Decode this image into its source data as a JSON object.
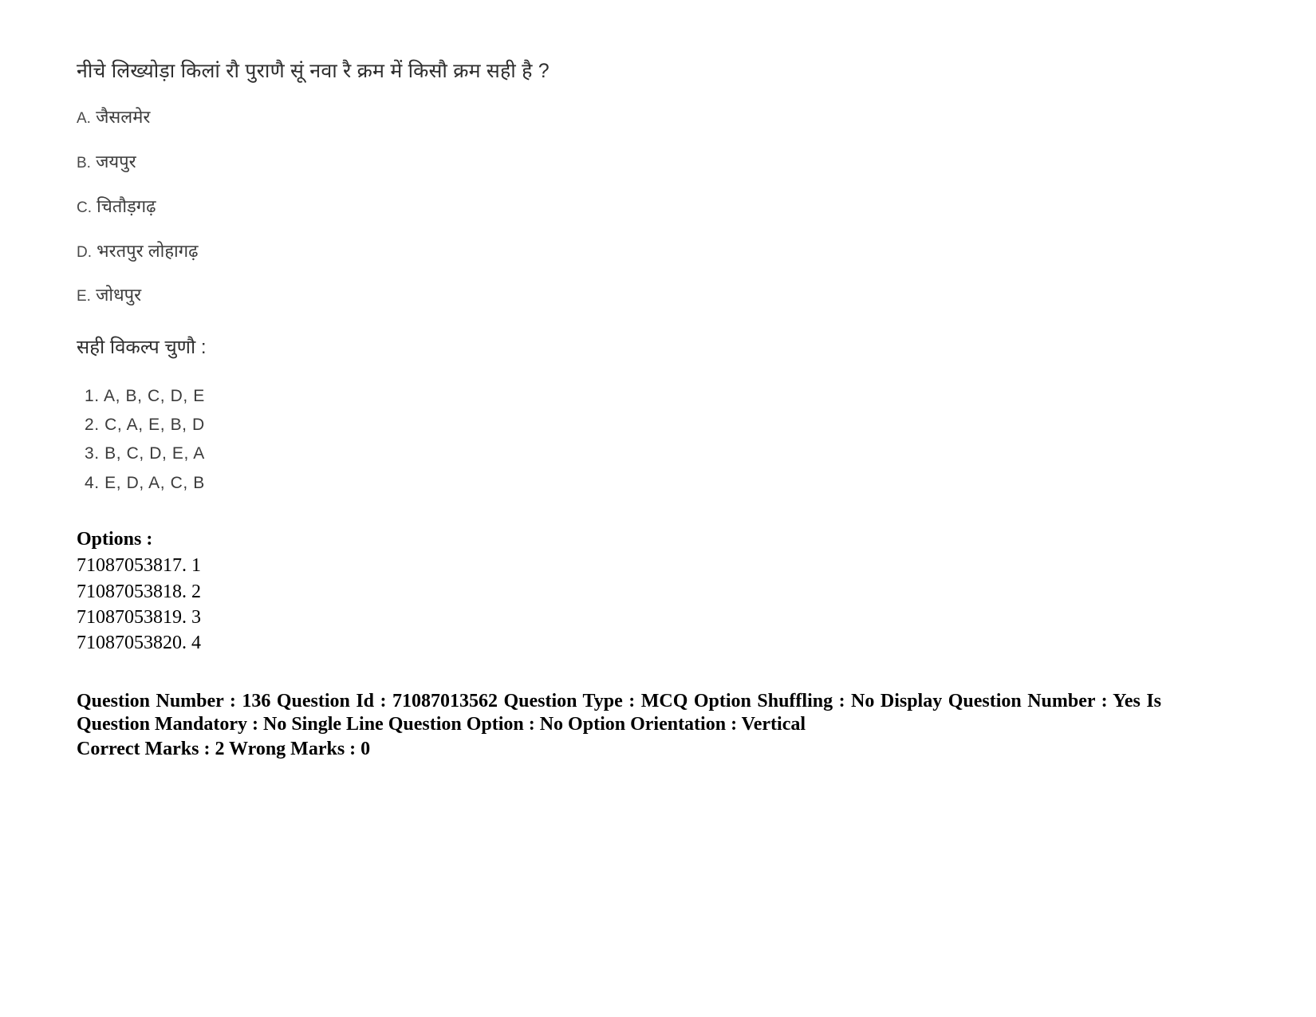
{
  "question": {
    "text": "नीचे लिख्योड़ा किलां रौ पुराणै सूं नवा रै  क्रम में किसौ क्रम सही है ?",
    "choices": [
      {
        "label": "A.",
        "text": "जैसलमेर"
      },
      {
        "label": "B.",
        "text": "जयपुर"
      },
      {
        "label": "C.",
        "text": "चितौड़गढ़"
      },
      {
        "label": "D.",
        "text": "भरतपुर लोहागढ़"
      },
      {
        "label": "E.",
        "text": "जोधपुर"
      }
    ],
    "prompt": "सही विकल्प चुणौ :",
    "answers": [
      "1. A, B, C, D, E",
      "2. C, A, E, B, D",
      "3. B, C, D, E, A",
      "4. E, D, A, C, B"
    ]
  },
  "options": {
    "title": "Options :",
    "rows": [
      "71087053817. 1",
      "71087053818. 2",
      "71087053819. 3",
      "71087053820. 4"
    ]
  },
  "meta": {
    "line1": "Question Number : 136 Question Id : 71087013562 Question Type : MCQ Option Shuffling : No Display Question Number : Yes Is Question Mandatory : No Single Line Question Option : No Option Orientation : Vertical",
    "line2": "Correct Marks : 2 Wrong Marks : 0"
  }
}
